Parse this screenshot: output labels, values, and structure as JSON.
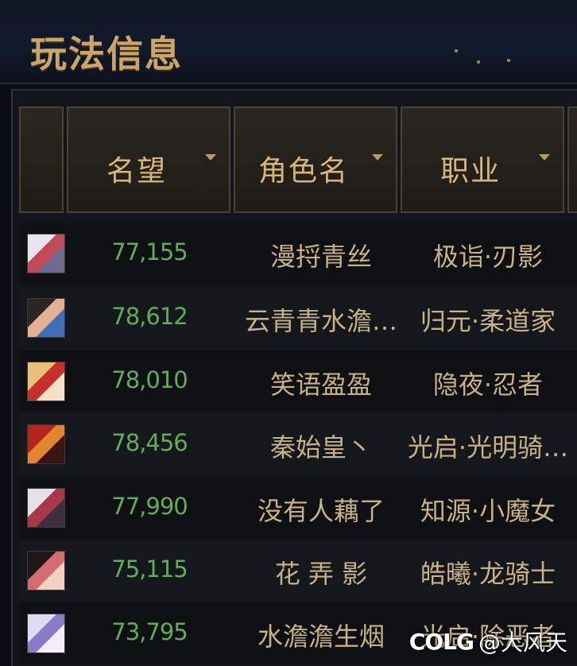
{
  "header": {
    "title": "玩法信息"
  },
  "table": {
    "columns": [
      {
        "label": "名望"
      },
      {
        "label": "角色名"
      },
      {
        "label": "职业"
      }
    ],
    "rows": [
      {
        "fame": "77,155",
        "name": "漫捋青丝",
        "job": "极诣·刃影",
        "avatar_colors": [
          "#e8e4ef",
          "#c24a58",
          "#6f6a8d"
        ]
      },
      {
        "fame": "78,612",
        "name": "云青青水澹…",
        "job": "归元·柔道家",
        "avatar_colors": [
          "#2b2623",
          "#e3b090",
          "#3f6eb8"
        ]
      },
      {
        "fame": "78,010",
        "name": "笑语盈盈",
        "job": "隐夜·忍者",
        "avatar_colors": [
          "#e9c07a",
          "#c7302a",
          "#f6e2c4"
        ]
      },
      {
        "fame": "78,456",
        "name": "秦始皇丶",
        "job": "光启·光明骑…",
        "avatar_colors": [
          "#b5231c",
          "#e2852f",
          "#3a1410"
        ]
      },
      {
        "fame": "77,990",
        "name": "没有人藕了",
        "job": "知源·小魔女",
        "avatar_colors": [
          "#e7e0e8",
          "#a8374a",
          "#3c3140"
        ]
      },
      {
        "fame": "75,115",
        "name": "花 弄 影",
        "job": "皓曦·龙骑士",
        "avatar_colors": [
          "#1e1618",
          "#d36d6d",
          "#f1d0c0"
        ]
      },
      {
        "fame": "73,795",
        "name": "水澹澹生烟",
        "job": "光启·除恶者",
        "avatar_colors": [
          "#dcdcf2",
          "#8a7cc4",
          "#f4eefa"
        ]
      }
    ]
  },
  "watermark": {
    "logo": "COLG",
    "text": "@大风天"
  }
}
